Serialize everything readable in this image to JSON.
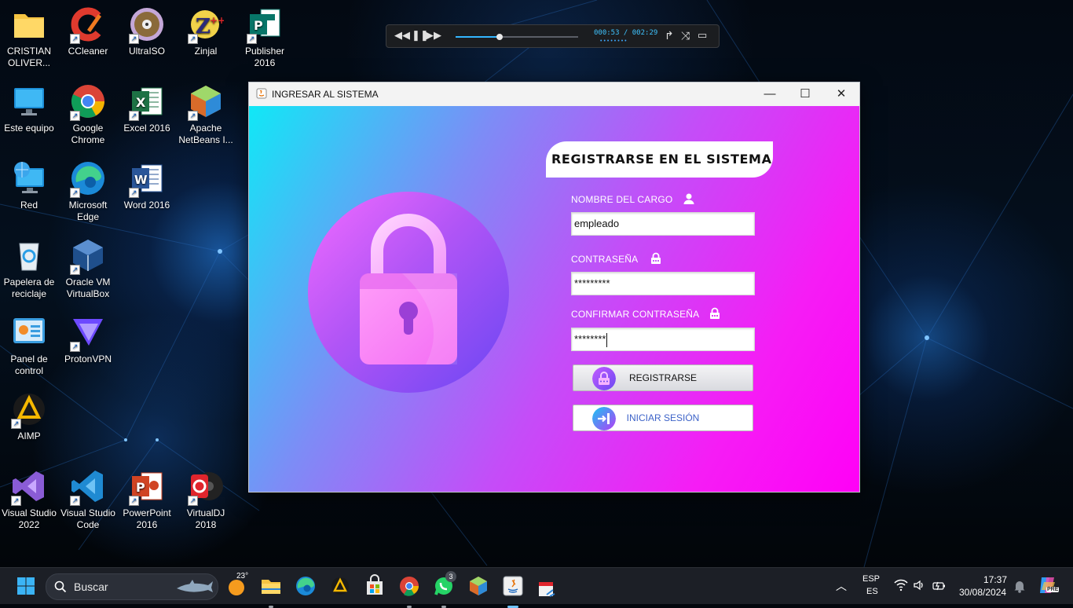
{
  "desktop": {
    "icons": [
      {
        "name": "folder-icon",
        "label": "CRISTIAN OLIVER..."
      },
      {
        "name": "ccleaner-icon",
        "label": "CCleaner"
      },
      {
        "name": "ultraiso-icon",
        "label": "UltraISO"
      },
      {
        "name": "zinjal-icon",
        "label": "Zinjal"
      },
      {
        "name": "publisher-icon",
        "label": "Publisher 2016"
      },
      {
        "name": "computer-icon",
        "label": "Este equipo"
      },
      {
        "name": "chrome-icon",
        "label": "Google Chrome"
      },
      {
        "name": "excel-icon",
        "label": "Excel 2016"
      },
      {
        "name": "netbeans-icon",
        "label": "Apache NetBeans I..."
      },
      {
        "name": "network-icon",
        "label": "Red"
      },
      {
        "name": "edge-icon",
        "label": "Microsoft Edge"
      },
      {
        "name": "word-icon",
        "label": "Word 2016"
      },
      {
        "name": "recycle-bin-icon",
        "label": "Papelera de reciclaje"
      },
      {
        "name": "virtualbox-icon",
        "label": "Oracle VM VirtualBox"
      },
      {
        "name": "control-panel-icon",
        "label": "Panel de control"
      },
      {
        "name": "protonvpn-icon",
        "label": "ProtonVPN"
      },
      {
        "name": "aimp-icon",
        "label": "AIMP"
      },
      {
        "name": "visual-studio-icon",
        "label": "Visual Studio 2022"
      },
      {
        "name": "vscode-icon",
        "label": "Visual Studio Code"
      },
      {
        "name": "powerpoint-icon",
        "label": "PowerPoint 2016"
      },
      {
        "name": "virtualdj-icon",
        "label": "VirtualDJ 2018"
      }
    ]
  },
  "player": {
    "time": "000:53 / 002:29",
    "progress": 0.36,
    "icons": [
      "rewind-icon",
      "pause-icon",
      "fast-forward-icon",
      "repeat-icon",
      "shuffle-icon",
      "playlist-icon"
    ]
  },
  "window": {
    "title": "INGRESAR AL SISTEMA",
    "minimize": "—",
    "maximize": "☐",
    "close": "✕",
    "header": "REGISTRARSE EN EL SISTEMA",
    "fields": {
      "cargo_label": "NOMBRE DEL CARGO",
      "cargo_value": "empleado",
      "password_label": "CONTRASEÑA",
      "password_value": "*********",
      "confirm_label": "CONFIRMAR CONTRASEÑA",
      "confirm_value": "********"
    },
    "buttons": {
      "register": "REGISTRARSE",
      "login": "INICIAR SESIÓN"
    },
    "colors": {
      "gradient_start": "#10e8f6",
      "gradient_end": "#ff00f6",
      "login_text": "#3d63c8"
    }
  },
  "taskbar": {
    "search_placeholder": "Buscar",
    "weather": "23°",
    "whatsapp_badge": "3",
    "lang_top": "ESP",
    "lang_bottom": "ES",
    "time": "17:37",
    "date": "30/08/2024",
    "copilot_badge": "PRE"
  }
}
